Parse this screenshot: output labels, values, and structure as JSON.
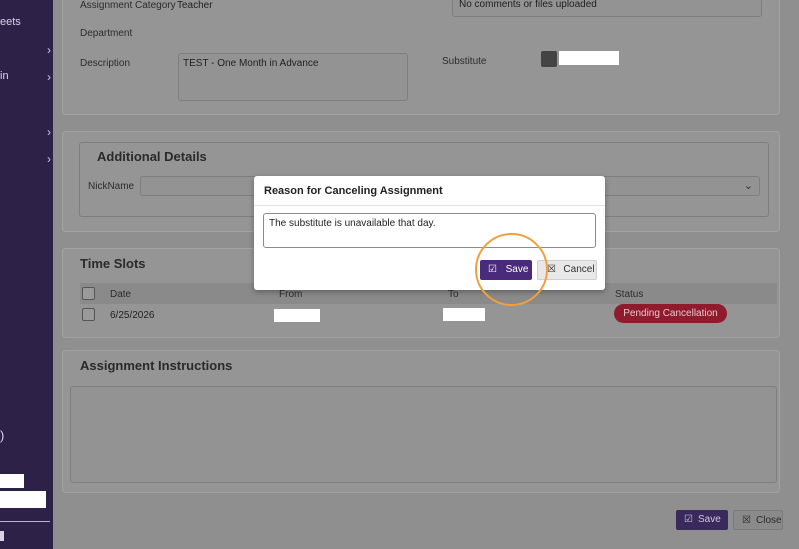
{
  "sidebar": {
    "items": [
      {
        "label": "eets",
        "chevron": ""
      },
      {
        "label": "",
        "chevron": "›"
      },
      {
        "label": "in",
        "chevron": "›"
      },
      {
        "label": "",
        "chevron": "›"
      },
      {
        "label": "",
        "chevron": "›"
      }
    ],
    "paren": ")"
  },
  "assignment": {
    "category_label": "Assignment Category",
    "category_value": "Teacher",
    "department_label": "Department",
    "description_label": "Description",
    "description_value": "TEST - One Month in Advance",
    "substitute_label": "Substitute",
    "comments_value": "No comments or files uploaded"
  },
  "additional_details": {
    "heading": "Additional Details",
    "nickname_label": "NickName"
  },
  "time_slots": {
    "heading": "Time Slots",
    "columns": [
      "Date",
      "From",
      "To",
      "Status"
    ],
    "rows": [
      {
        "date": "6/25/2026",
        "status": "Pending Cancellation"
      }
    ]
  },
  "instructions": {
    "heading": "Assignment Instructions"
  },
  "footer": {
    "save_label": "Save",
    "close_label": "Close"
  },
  "modal": {
    "title": "Reason for Canceling Assignment",
    "reason_text": "The substitute is unavailable that day.",
    "save_label": "Save",
    "cancel_label": "Cancel"
  },
  "colors": {
    "sidebar": "#2e2148",
    "primary": "#4a2a7a",
    "status_badge": "#c2203a",
    "highlight": "#f0a03c"
  }
}
